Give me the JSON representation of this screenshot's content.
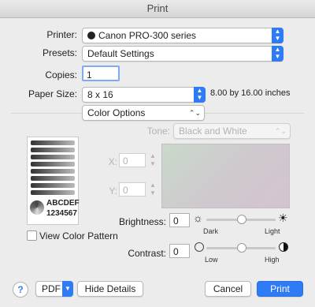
{
  "window": {
    "title": "Print"
  },
  "printer": {
    "label": "Printer:",
    "value": "Canon PRO-300 series"
  },
  "presets": {
    "label": "Presets:",
    "value": "Default Settings"
  },
  "copies": {
    "label": "Copies:",
    "value": "1"
  },
  "paper_size": {
    "label": "Paper Size:",
    "value": "8 x 16",
    "dimensions": "8.00 by 16.00 inches"
  },
  "section": {
    "value": "Color Options"
  },
  "tone": {
    "label": "Tone:",
    "value": "Black and White"
  },
  "x_field": {
    "label": "X:",
    "value": "0"
  },
  "y_field": {
    "label": "Y:",
    "value": "0"
  },
  "preview": {
    "text_line1": "ABCDEF",
    "text_line2": "1234567"
  },
  "view_color_pattern": {
    "label": "View Color Pattern",
    "checked": false
  },
  "brightness": {
    "label": "Brightness:",
    "value": "0",
    "min_label": "Dark",
    "max_label": "Light",
    "level": 0.5
  },
  "contrast": {
    "label": "Contrast:",
    "value": "0",
    "min_label": "Low",
    "max_label": "High",
    "level": 0.5
  },
  "footer": {
    "help": "?",
    "pdf": "PDF",
    "details": "Hide Details",
    "cancel": "Cancel",
    "print": "Print"
  },
  "colors": {
    "accent": "#2f7bf5",
    "background": "#ececec"
  }
}
